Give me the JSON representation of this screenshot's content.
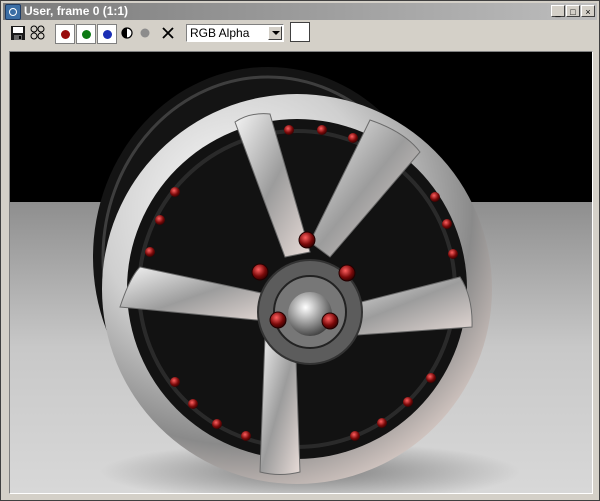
{
  "window": {
    "title": "User, frame 0 (1:1)",
    "minimize_glyph": "_",
    "restore_glyph": "□",
    "close_glyph": "×"
  },
  "toolbar": {
    "icons": [
      "save-icon",
      "clone-icon",
      "red-channel-icon",
      "green-channel-icon",
      "blue-channel-icon",
      "mono-icon",
      "alpha-icon",
      "clear-icon"
    ],
    "channel_colors": {
      "red": "#9a0d0d",
      "green": "#0d7a14",
      "blue": "#1b2fb5"
    },
    "channel_display": {
      "selected": "RGB Alpha"
    },
    "swatch_color": "#ffffff"
  },
  "render": {
    "description_icon": "wheel-render-image",
    "background_top": "#000000",
    "floor_color": "#b9b9b9"
  }
}
